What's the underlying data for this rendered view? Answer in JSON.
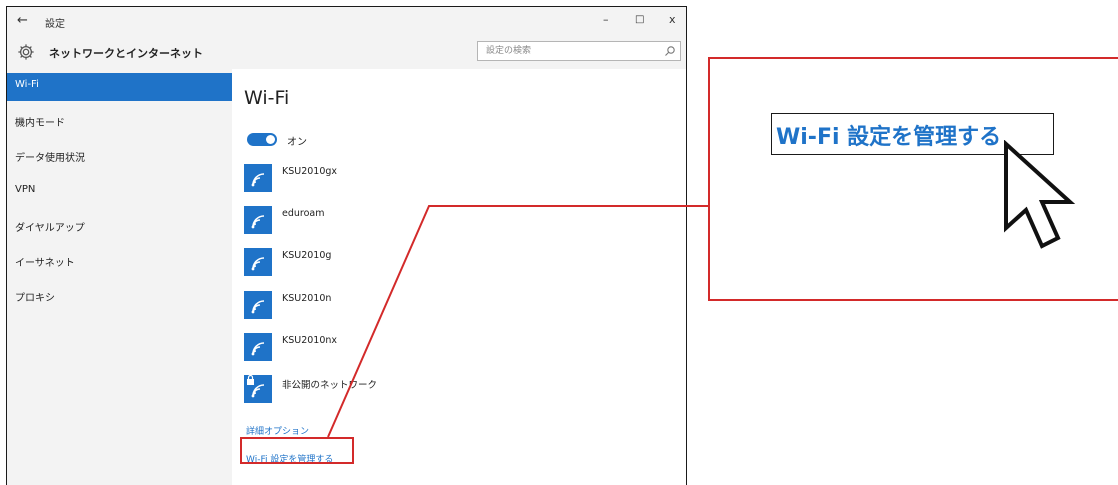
{
  "window": {
    "back": "←",
    "title": "設定",
    "controls": {
      "minimize": "–",
      "maximize": "□",
      "close": "x"
    }
  },
  "header": {
    "section_title": "ネットワークとインターネット",
    "search_placeholder": "設定の検索"
  },
  "sidebar": {
    "items": [
      {
        "label": "Wi-Fi",
        "active": true
      },
      {
        "label": "機内モード"
      },
      {
        "label": "データ使用状況"
      },
      {
        "label": "VPN"
      },
      {
        "label": "ダイヤルアップ"
      },
      {
        "label": "イーサネット"
      },
      {
        "label": "プロキシ"
      }
    ]
  },
  "main": {
    "title": "Wi-Fi",
    "toggle_label": "オン",
    "networks": [
      {
        "name": "KSU2010gx"
      },
      {
        "name": "eduroam"
      },
      {
        "name": "KSU2010g"
      },
      {
        "name": "KSU2010n"
      },
      {
        "name": "KSU2010nx"
      },
      {
        "name": "非公開のネットワーク"
      }
    ],
    "advanced_options_link": "詳細オプション",
    "manage_wifi_link": "Wi-Fi 設定を管理する"
  },
  "callout": {
    "label": "Wi-Fi 設定を管理する"
  },
  "colors": {
    "accent": "#1f73c8",
    "highlight": "#d32a2a",
    "sidebar_bg": "#f3f3f3"
  },
  "icons": [
    "back-arrow-icon",
    "gear-icon",
    "search-icon",
    "wifi-icon",
    "wifi-lock-icon",
    "mouse-cursor-icon"
  ]
}
